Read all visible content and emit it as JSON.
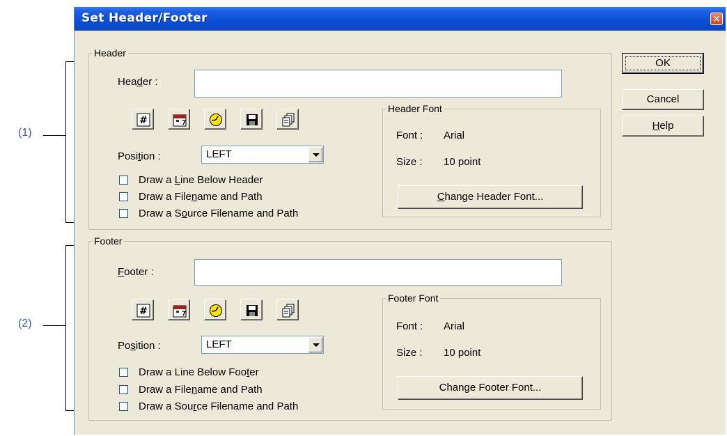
{
  "annotations": {
    "section1": "(1)",
    "section2": "(2)"
  },
  "window": {
    "title": "Set Header/Footer",
    "close_glyph": "✕"
  },
  "header": {
    "group_label": "Header",
    "field_label_pre": "Hea",
    "field_label_u": "d",
    "field_label_post": "er :",
    "value": "",
    "position_label_pre": "Posi",
    "position_label_u": "t",
    "position_label_post": "ion :",
    "position_value": "LEFT",
    "checkboxes": [
      {
        "pre": "Draw a ",
        "u": "L",
        "post": "ine Below Header"
      },
      {
        "pre": "Draw a File",
        "u": "n",
        "post": "ame and Path"
      },
      {
        "pre": "Draw a S",
        "u": "o",
        "post": "urce Filename and Path"
      }
    ],
    "font_group_label": "Header Font",
    "font_label": "Font :",
    "font_value": "Arial",
    "size_label": "Size :",
    "size_value": "10 point",
    "change_pre": "",
    "change_u": "C",
    "change_post": "hange Header Font..."
  },
  "footer": {
    "group_label": "Footer",
    "field_label_pre": "",
    "field_label_u": "F",
    "field_label_post": "ooter :",
    "value": "",
    "position_label_pre": "Po",
    "position_label_u": "s",
    "position_label_post": "ition :",
    "position_value": "LEFT",
    "checkboxes": [
      {
        "pre": "Draw a Line Below Foo",
        "u": "t",
        "post": "er"
      },
      {
        "pre": "Draw a File",
        "u": "n",
        "post": "ame and Path"
      },
      {
        "pre": "Draw a Sou",
        "u": "r",
        "post": "ce Filename and Path"
      }
    ],
    "font_group_label": "Footer Font",
    "font_label": "Font :",
    "font_value": "Arial",
    "size_label": "Size :",
    "size_value": "10 point",
    "change_pre": "Chan",
    "change_u": "g",
    "change_post": "e Footer Font..."
  },
  "toolbar_icons": [
    "page-number-icon",
    "date-icon",
    "clock-icon",
    "save-disk-icon",
    "copy-pages-icon"
  ],
  "buttons": {
    "ok": "OK",
    "cancel": "Cancel",
    "help_u": "H",
    "help_post": "elp"
  }
}
